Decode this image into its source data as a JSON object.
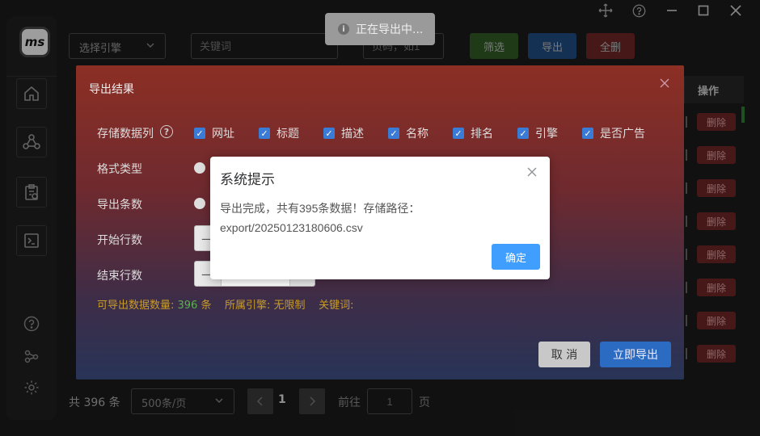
{
  "app": {
    "logo_text": "ms"
  },
  "toolbar": {
    "engine_select": "选择引擎",
    "keyword_placeholder": "关键词",
    "page_placeholder": "页码，如1",
    "filter_label": "筛选",
    "export_label": "导出",
    "delete_all_label": "全删"
  },
  "table": {
    "action_header": "操作",
    "delete_label": "删除",
    "row_count": 8
  },
  "pagination": {
    "total": "共 396 条",
    "per_page": "500条/页",
    "current_page": "1",
    "goto_label": "前往",
    "goto_value": "1",
    "page_unit": "页"
  },
  "toast": {
    "text": "正在导出中..."
  },
  "export_dialog": {
    "title": "导出结果",
    "columns_label": "存储数据列",
    "columns": [
      "网址",
      "标题",
      "描述",
      "名称",
      "排名",
      "引擎",
      "是否广告"
    ],
    "format_label": "格式类型",
    "count_label": "导出条数",
    "start_label": "开始行数",
    "end_label": "结束行数",
    "available_prefix": "可导出数据数量:",
    "available_count": "396",
    "available_unit": "条",
    "engine_info": "所属引擎: 无限制",
    "keyword_info": "关键词:",
    "cancel_label": "取 消",
    "export_now_label": "立即导出"
  },
  "message_box": {
    "title": "系统提示",
    "line1": "导出完成，共有395条数据！存储路径：",
    "line2": "export/20250123180606.csv",
    "ok_label": "确定"
  },
  "colors": {
    "accent_blue": "#409eff",
    "danger": "#6e2525",
    "success": "#58b34a",
    "warning": "#c79a2a"
  }
}
